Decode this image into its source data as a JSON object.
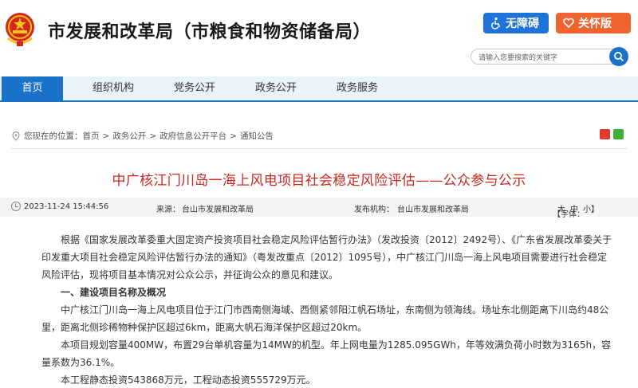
{
  "header": {
    "site_title": "市发展和改革局（市粮食和物资储备局）",
    "accessibility_button": "无障碍",
    "care_mode_button": "关怀版",
    "search_placeholder": "请输入您要搜索的关键字"
  },
  "nav": {
    "items": [
      {
        "label": "首页",
        "active": true
      },
      {
        "label": "组织机构",
        "active": false
      },
      {
        "label": "党务公开",
        "active": false
      },
      {
        "label": "政务公开",
        "active": false
      },
      {
        "label": "政务服务",
        "active": false
      }
    ]
  },
  "breadcrumb": {
    "prefix": "您现在的位置：",
    "items": [
      "首页",
      ">",
      "政务公开",
      ">",
      "政府信息公开平台",
      ">",
      "通知公告"
    ]
  },
  "article": {
    "title": "中广核江门川岛一海上风电项目社会稳定风险评估——公众参与公示",
    "date": "2023-11-24 15:44:56",
    "source_label": "来源：",
    "source": "台山市发展和改革局",
    "publisher_label": "发布机构：",
    "publisher": "台山市发展和改革局",
    "font_label": "【字体：",
    "font_large": "大",
    "font_medium": "中",
    "font_small": "小】",
    "paragraphs": [
      "根据《国家发展改革委重大固定资产投资项目社会稳定风险评估暂行办法》（发改投资〔2012〕2492号）、《广东省发展改革委关于印发重大项目社会稳定风险评估暂行办法的通知》（粤发改重点〔2012〕1095号），中广核江门川岛一海上风电项目需要进行社会稳定风险评估，现将项目基本情况对公众公示，并征询公众的意见和建议。",
      "一、建设项目名称及概况",
      "中广核江门川岛一海上风电项目位于江门市西南侧海域、西侧紧邻阳江帆石场址，东南侧为领海线。场址东北侧距离下川岛约48公里，距离北侧珍稀物种保护区超过6km，距离大帆石海洋保护区超过20km。",
      "本项目规划容量400MW，布置29台单机容量为14MW的机型。年上网电量为1285.095GWh，年等效满负荷小时数为3165h，容量系数为36.1%。",
      "本工程静态投资543868万元，工程动态投资555729万元。"
    ]
  },
  "colors": {
    "primary_blue": "#1a73c9",
    "title_red": "#c8281e",
    "care_orange": "#f0632f"
  }
}
